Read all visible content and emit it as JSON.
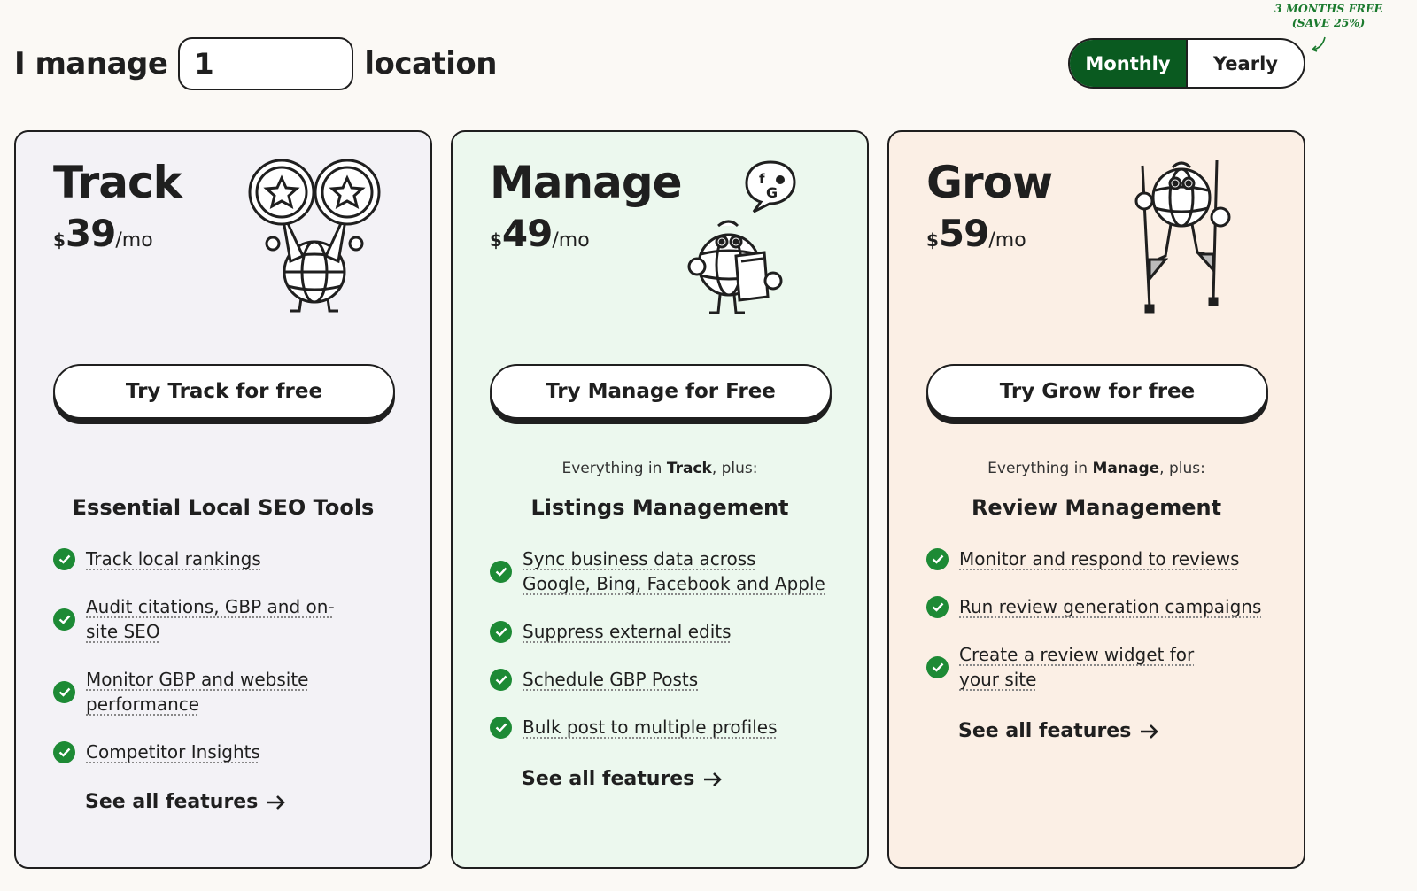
{
  "header": {
    "prefix": "I manage",
    "locations_value": "1",
    "suffix": "location"
  },
  "billing": {
    "monthly": "Monthly",
    "yearly": "Yearly",
    "selected": "Monthly",
    "promo_line1": "3 MONTHS FREE",
    "promo_line2": "(SAVE 25%)"
  },
  "plans": [
    {
      "name": "Track",
      "currency": "$",
      "price": "39",
      "period": "/mo",
      "cta": "Try Track for free",
      "plus_prefix": "",
      "plus_plan": "",
      "plus_suffix": "",
      "section": "Essential Local SEO Tools",
      "features": [
        "Track local rankings",
        "Audit citations, GBP and on-site SEO",
        "Monitor GBP and website performance",
        "Competitor Insights"
      ],
      "see_all": "See all features",
      "illustration": "binoculars-globe-icon"
    },
    {
      "name": "Manage",
      "currency": "$",
      "price": "49",
      "period": "/mo",
      "cta": "Try Manage for Free",
      "plus_prefix": "Everything in ",
      "plus_plan": "Track",
      "plus_suffix": ", plus:",
      "section": "Listings Management",
      "features": [
        "Sync business data across Google, Bing, Facebook and Apple",
        "Suppress external edits",
        "Schedule GBP Posts",
        "Bulk post to multiple profiles"
      ],
      "see_all": "See all features",
      "illustration": "globe-reading-icon"
    },
    {
      "name": "Grow",
      "currency": "$",
      "price": "59",
      "period": "/mo",
      "cta": "Try Grow for free",
      "plus_prefix": "Everything in ",
      "plus_plan": "Manage",
      "plus_suffix": ", plus:",
      "section": "Review Management",
      "features": [
        "Monitor and respond to reviews",
        "Run review generation campaigns",
        "Create a review widget for your site"
      ],
      "see_all": "See all features",
      "illustration": "globe-on-stilts-icon"
    }
  ],
  "colors": {
    "accent_green": "#0a5a20",
    "check_green": "#1d8a35",
    "track_bg": "#f3f2f6",
    "manage_bg": "#ecf8ee",
    "grow_bg": "#fbefe5"
  }
}
